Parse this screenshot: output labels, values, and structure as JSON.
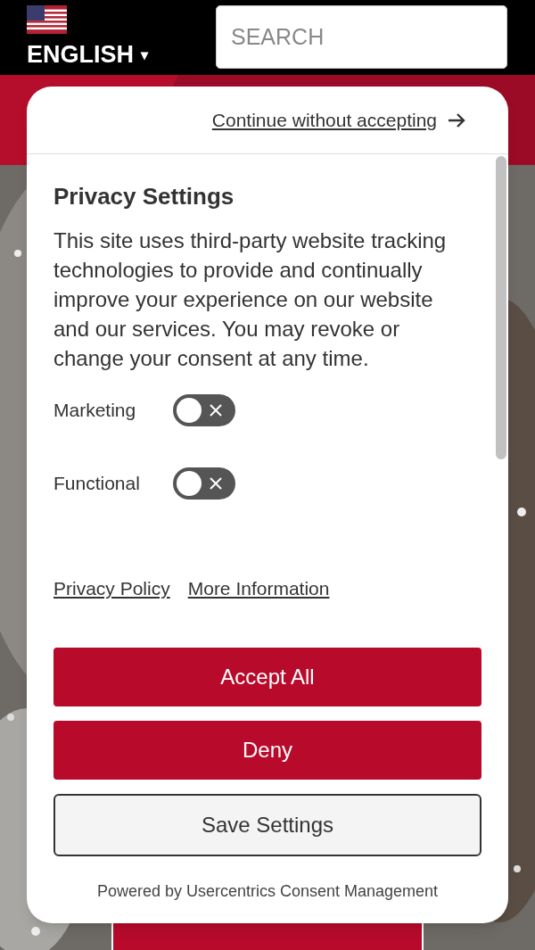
{
  "header": {
    "language": "ENGLISH",
    "language_caret": "▾",
    "search": {
      "placeholder": "SEARCH"
    }
  },
  "consent": {
    "continue_link": "Continue without accepting",
    "title": "Privacy Settings",
    "description": "This site uses third-party website tracking technologies to provide and continually improve your experience on our website and our services. You may revoke or change your consent at any time.",
    "categories": [
      {
        "label": "Marketing",
        "on": false
      },
      {
        "label": "Functional",
        "on": false
      }
    ],
    "links": [
      "Privacy Policy",
      "More Information"
    ],
    "buttons": [
      {
        "label": "Accept All",
        "kind": "primary"
      },
      {
        "label": "Deny",
        "kind": "primary"
      },
      {
        "label": "Save Settings",
        "kind": "secondary"
      }
    ],
    "footer": "Powered by Usercentrics Consent Management"
  }
}
